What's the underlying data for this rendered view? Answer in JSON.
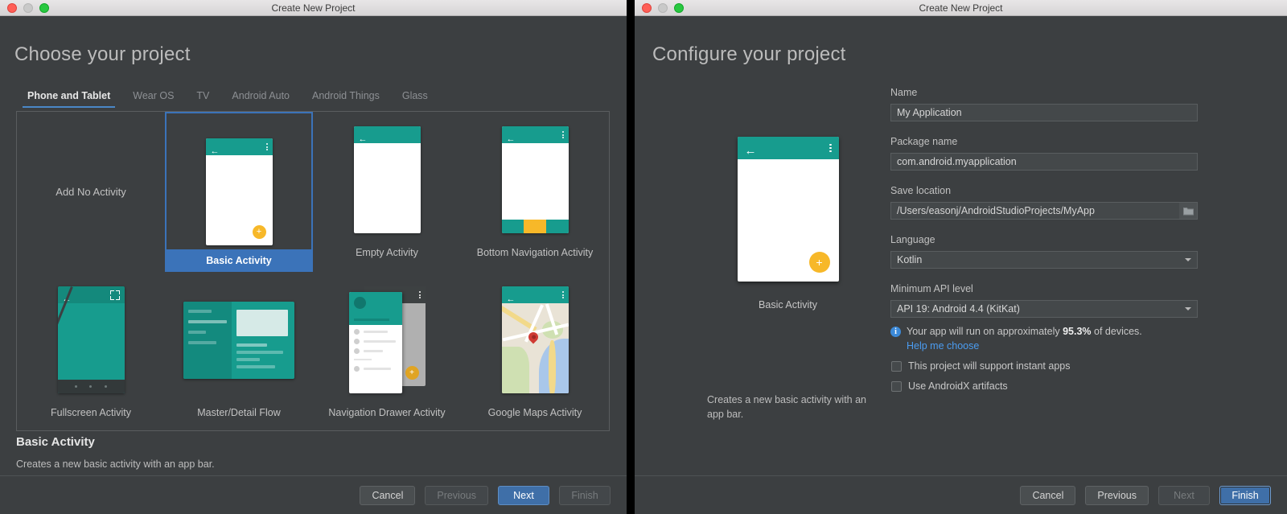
{
  "left_window": {
    "window_title": "Create New Project",
    "page_title": "Choose your project",
    "tabs": [
      {
        "label": "Phone and Tablet",
        "active": true
      },
      {
        "label": "Wear OS",
        "active": false
      },
      {
        "label": "TV",
        "active": false
      },
      {
        "label": "Android Auto",
        "active": false
      },
      {
        "label": "Android Things",
        "active": false
      },
      {
        "label": "Glass",
        "active": false
      }
    ],
    "templates": [
      {
        "label": "Add No Activity",
        "kind": "text"
      },
      {
        "label": "Basic Activity",
        "kind": "basic",
        "selected": true
      },
      {
        "label": "Empty Activity",
        "kind": "empty"
      },
      {
        "label": "Bottom Navigation Activity",
        "kind": "bottomnav"
      },
      {
        "label": "Fullscreen Activity",
        "kind": "fullscreen"
      },
      {
        "label": "Master/Detail Flow",
        "kind": "masterdetail"
      },
      {
        "label": "Navigation Drawer Activity",
        "kind": "navdrawer"
      },
      {
        "label": "Google Maps Activity",
        "kind": "maps"
      }
    ],
    "selection_title": "Basic Activity",
    "selection_description": "Creates a new basic activity with an app bar.",
    "buttons": {
      "cancel": "Cancel",
      "previous": "Previous",
      "next": "Next",
      "finish": "Finish"
    }
  },
  "right_window": {
    "window_title": "Create New Project",
    "page_title": "Configure your project",
    "preview": {
      "caption": "Basic Activity",
      "description": "Creates a new basic activity with an app bar."
    },
    "form": {
      "name_label": "Name",
      "name_value": "My Application",
      "package_label": "Package name",
      "package_value": "com.android.myapplication",
      "save_location_label": "Save location",
      "save_location_value": "/Users/easonj/AndroidStudioProjects/MyApp",
      "language_label": "Language",
      "language_value": "Kotlin",
      "min_api_label": "Minimum API level",
      "min_api_value": "API 19: Android 4.4 (KitKat)",
      "info_prefix": "Your app will run on approximately ",
      "info_percent": "95.3%",
      "info_suffix": " of devices.",
      "help_link": "Help me choose",
      "instant_apps_label": "This project will support instant apps",
      "androidx_label": "Use AndroidX artifacts"
    },
    "buttons": {
      "cancel": "Cancel",
      "previous": "Previous",
      "next": "Next",
      "finish": "Finish"
    }
  },
  "colors": {
    "window_bg": "#3c3f41",
    "accent_blue": "#3b73b9",
    "android_teal": "#179c8e",
    "fab_amber": "#f7b829",
    "link_blue": "#4b9cf0"
  }
}
